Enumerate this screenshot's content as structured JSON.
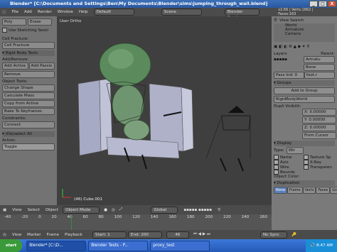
{
  "window": {
    "title": "Blender* [C:\\Documents and Settings\\Ben\\My Documents\\Blender\\sims\\jumping_through_wall.blend]",
    "min": "_",
    "max": "□",
    "close": "X"
  },
  "menubar": {
    "items": [
      "File",
      "Add",
      "Render",
      "Window",
      "Help"
    ],
    "layout": "Default",
    "scene": "Scene",
    "engine": "Blender Render",
    "stats": "v2.66 | Verts:1662 | Faces:163"
  },
  "left_panel": {
    "top_buttons": [
      "Poly",
      "Erase"
    ],
    "use_sketching": "Use Sketching Sessi",
    "cell_fracture_label": "Cell Fracture:",
    "cell_fracture_button": "Cell Fracture",
    "rigid_body_tools": "Rigid Body Tools",
    "add_remove_label": "Add/Remove:",
    "add_active": "Add Active",
    "add_passive": "Add Passiv",
    "remove": "Remove",
    "object_tools_label": "Object Tools:",
    "change_shape": "Change Shape",
    "calculate_mass": "Calculate Mass",
    "copy_from_active": "Copy from Active",
    "bake_to_keyframes": "Bake To Keyframes",
    "constraints_label": "Constraints:",
    "connect": "Connect",
    "deselect_all": "(De)select All",
    "action_label": "Action:",
    "action_value": "Toggle"
  },
  "viewport": {
    "label": "User Ortho",
    "object_info": "(46) Cube.001"
  },
  "toolbar3d": {
    "view": "View",
    "select": "Select",
    "object": "Object",
    "mode": "Object Mode",
    "orientation": "Global"
  },
  "timeline": {
    "ticks": [
      "-40",
      "-20",
      "0",
      "20",
      "40",
      "60",
      "80",
      "100",
      "120",
      "140",
      "160",
      "180",
      "200",
      "220",
      "240",
      "260"
    ]
  },
  "timeline_bar": {
    "view": "View",
    "marker": "Marker",
    "frame": "Frame",
    "playback": "Playback",
    "start": "Start: 1",
    "end": "End: 200",
    "current": "46",
    "sync": "No Sync"
  },
  "right_panel": {
    "view_search": "View  Search",
    "outliner": [
      "World",
      "Armature",
      "Camera"
    ],
    "layers_label": "Layers",
    "parent_label": "Parent:",
    "parent_value": "Armatu",
    "parent_type": "Bone",
    "parent_bone": "foot.r",
    "pass_index": "Pass Ind: 0",
    "groups_label": "Groups",
    "add_to_group": "Add to Group",
    "group_name": "RigidBodyWorld",
    "dupli_label": "Dupli Visibilit:",
    "dupli_x": "X: 0.00000",
    "dupli_y": "Y: 0.00000",
    "dupli_z": "Z: 0.00000",
    "from_cursor": "From Cursor",
    "display_label": "Display",
    "type_label": "Type:",
    "type_value": "Wir",
    "checks_left": [
      "Name",
      "Axis",
      "Wire"
    ],
    "checks_right": [
      "Texture Sp",
      "X-Ray",
      "Transparen"
    ],
    "bounds": "Bounds",
    "object_color": "Object Color:",
    "duplication_label": "Duplication",
    "dup_buttons": [
      "None",
      "Frame",
      "Verts",
      "Faces",
      "Group"
    ]
  },
  "taskbar": {
    "start": "start",
    "tasks": [
      "Blender* [C:\\D...",
      "Blender Tests - P...",
      "proxy_test"
    ],
    "clock": "8:47 AM"
  }
}
